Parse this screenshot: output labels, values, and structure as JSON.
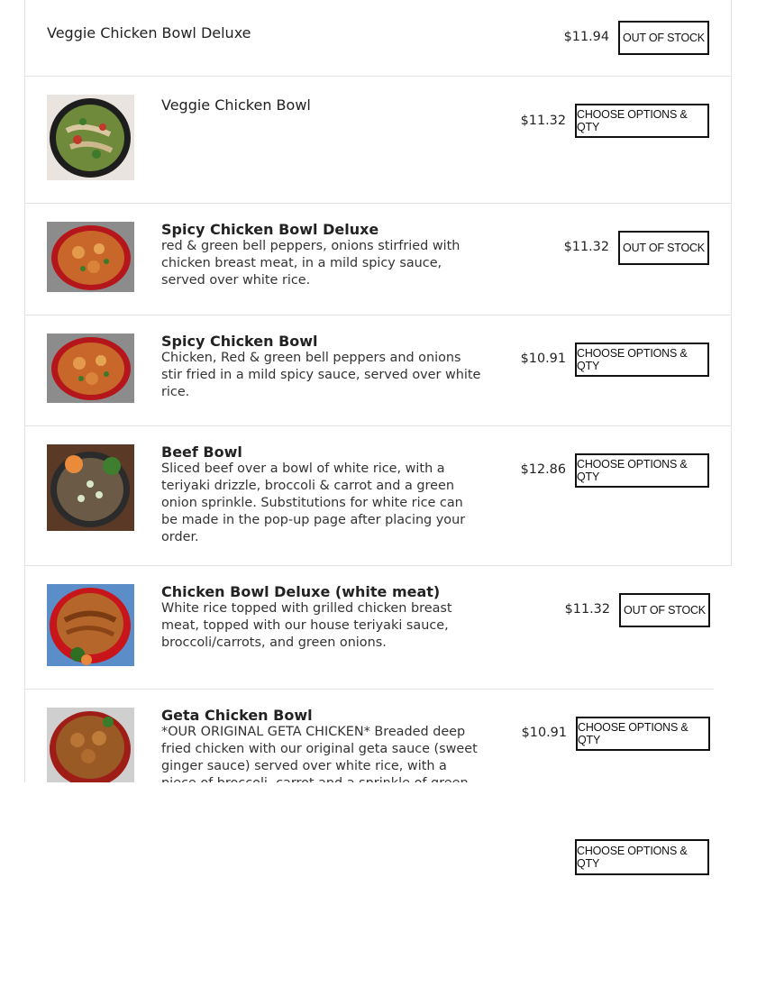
{
  "menu": {
    "items": [
      {
        "name": "Veggie Chicken Bowl Deluxe",
        "description": "",
        "price": "$11.94",
        "button": "OUT OF STOCK"
      },
      {
        "name": "Veggie Chicken Bowl",
        "description": "",
        "price": "$11.32",
        "button": "CHOOSE OPTIONS & QTY"
      },
      {
        "name": "Spicy Chicken Bowl Deluxe",
        "description": "red & green bell peppers, onions stirfried with chicken breast meat, in a mild spicy sauce, served over white rice.",
        "price": "$11.32",
        "button": "OUT OF STOCK"
      },
      {
        "name": "Spicy Chicken Bowl",
        "description": "Chicken, Red & green bell peppers and onions stir fried in a mild spicy sauce, served over white rice.",
        "price": "$10.91",
        "button": "CHOOSE OPTIONS & QTY"
      },
      {
        "name": "Beef Bowl",
        "description": "Sliced beef over a bowl of white rice, with a teriyaki drizzle, broccoli & carrot and a green onion sprinkle. Substitutions for white rice can be made in the pop-up page after placing your order.",
        "price": "$12.86",
        "button": "CHOOSE OPTIONS & QTY"
      },
      {
        "name": "Chicken Bowl Deluxe (white meat)",
        "description": "White rice topped with grilled chicken breast meat, topped with our house teriyaki sauce, broccoli/carrots, and green onions.",
        "price": "$11.32",
        "button": "OUT OF STOCK"
      },
      {
        "name": "Geta Chicken Bowl",
        "description": "*OUR ORIGINAL GETA CHICKEN* Breaded deep fried chicken with our original geta sauce (sweet ginger sauce) served over white rice, with a piece of broccoli, carrot and a sprinkle of green onion.",
        "price": "$10.91",
        "button": "CHOOSE OPTIONS & QTY"
      }
    ],
    "floating_button": "CHOOSE OPTIONS & QTY"
  }
}
